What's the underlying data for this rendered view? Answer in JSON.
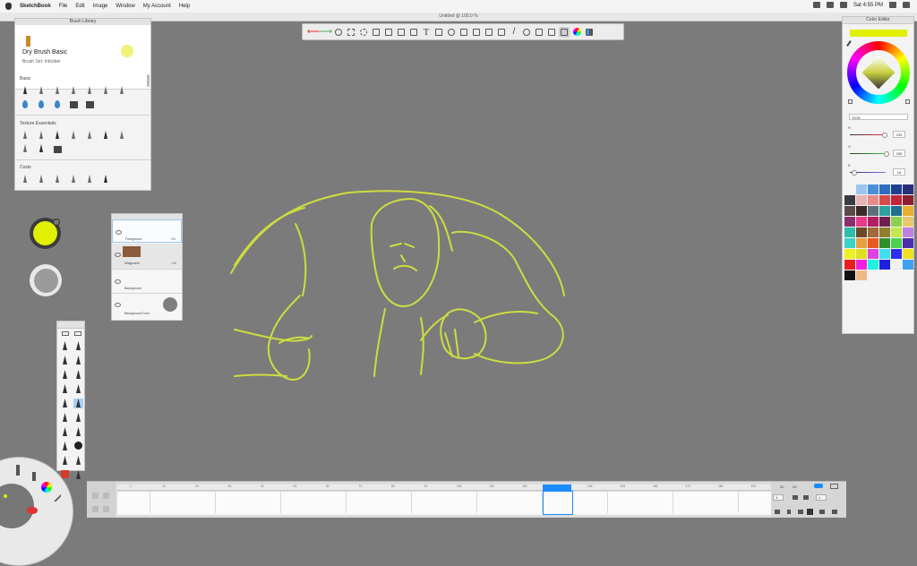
{
  "menubar": {
    "app": "SketchBook",
    "items": [
      "File",
      "Edit",
      "Image",
      "Window",
      "My Account",
      "Help"
    ],
    "clock": "Sat 4:55 PM"
  },
  "window_title": "Untitled @ 100.0 %",
  "brush_library": {
    "title": "Brush Library",
    "brush_name": "Dry Brush Basic",
    "brush_set": "Brush Set: Inktober",
    "sections": [
      "Basic",
      "Texture Essentials",
      "Costs"
    ]
  },
  "layers": {
    "items": [
      {
        "name": "Foreground",
        "mode": "Ctrl"
      },
      {
        "name": "Midground",
        "mode": "Ctrl"
      },
      {
        "name": "Background",
        "mode": ""
      },
      {
        "name": "Background Color",
        "mode": ""
      }
    ]
  },
  "color_editor": {
    "title": "Color Editor",
    "mode": "RGB",
    "sliders": [
      {
        "label": "R",
        "value": "239"
      },
      {
        "label": "G",
        "value": "255"
      },
      {
        "label": "B",
        "value": "16"
      }
    ],
    "current_color": "#e0f000"
  },
  "swatches": [
    "#f3f3f3",
    "#9cc6ef",
    "#4a90d9",
    "#2f6cc2",
    "#1e3f8f",
    "#2a2f7a",
    "#3b3b45",
    "#e8b4b4",
    "#e88a8a",
    "#d94a4a",
    "#c2243b",
    "#8f1f2f",
    "#5a4a4a",
    "#3a2a2a",
    "#5f6f7a",
    "#2f9f9f",
    "#1f6f8f",
    "#e8b030",
    "#8a2f6f",
    "#e83a8a",
    "#b01f5f",
    "#6f1f4f",
    "#8fcf4f",
    "#e8c86a",
    "#2fbfa8",
    "#6a4a2a",
    "#a06a3a",
    "#8f7f2f",
    "#c3e84f",
    "#c080e0",
    "#3ad4c8",
    "#e8a040",
    "#e85a20",
    "#2f8f2f",
    "#50d050",
    "#4f2fb0",
    "#f0f020",
    "#e0e020",
    "#e040e0",
    "#40e0f0",
    "#2f2ff0",
    "#f0e020",
    "#e81f1f",
    "#f01fe0",
    "#1ff0e0",
    "#1f1fe0",
    "#f0f0f0",
    "#40a0f0",
    "#111111",
    "#f0b888"
  ],
  "timeline": {
    "ticks": [
      "1",
      "11",
      "21",
      "31",
      "41",
      "51",
      "61",
      "71",
      "81",
      "91",
      "101",
      "111",
      "121",
      "131",
      "141",
      "151",
      "161",
      "171",
      "181",
      "191",
      "201"
    ],
    "current_frame": "131",
    "right_values": [
      "20",
      "20",
      "1",
      "1"
    ]
  }
}
